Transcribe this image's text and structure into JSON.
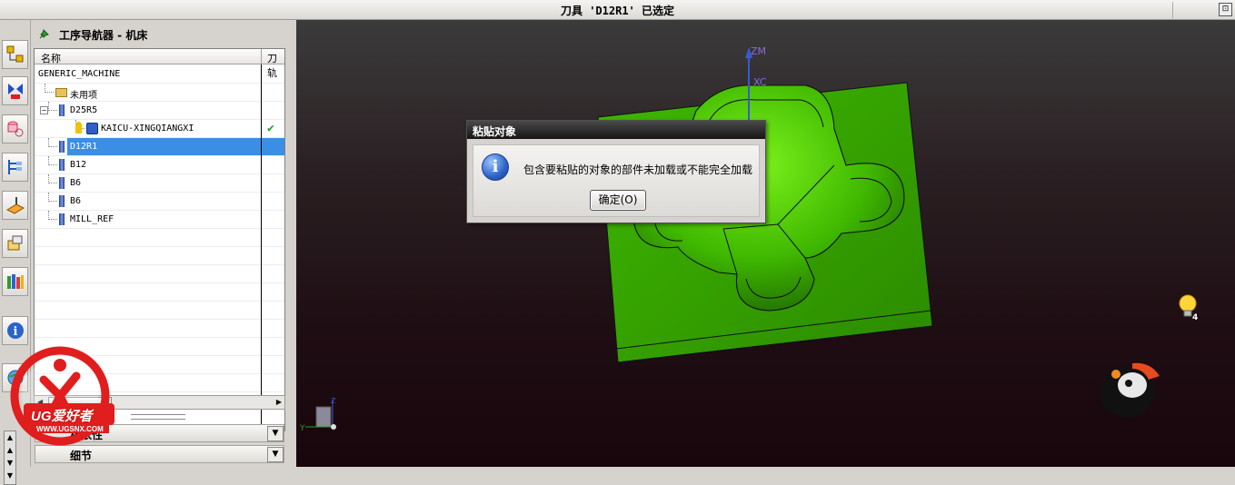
{
  "titlebar": {
    "title": "刀具 'D12R1' 已选定",
    "window_button": "⊡"
  },
  "navigator": {
    "title": "工序导航器 - 机床",
    "columns": {
      "name": "名称",
      "tool": "刀轨"
    },
    "rows": [
      {
        "label": "GENERIC_MACHINE",
        "icon": "none",
        "check": ""
      },
      {
        "label": "未用项",
        "icon": "folder-icon",
        "check": ""
      },
      {
        "label": "D25R5",
        "icon": "tool-icon",
        "check": ""
      },
      {
        "label": "KAICU-XINGQIANGXI",
        "icon": "operation-icon",
        "check": "✔"
      },
      {
        "label": "D12R1",
        "icon": "tool-icon",
        "check": "",
        "selected": true
      },
      {
        "label": "B12",
        "icon": "tool-icon",
        "check": ""
      },
      {
        "label": "B6",
        "icon": "tool-icon",
        "check": ""
      },
      {
        "label": "B6",
        "icon": "tool-icon",
        "check": ""
      },
      {
        "label": "MILL_REF",
        "icon": "tool-icon",
        "check": ""
      }
    ],
    "bottom_panels": [
      {
        "label": "相依性"
      },
      {
        "label": "细节"
      }
    ]
  },
  "viewport": {
    "axis_labels": {
      "zm": "ZM",
      "zc": "XC",
      "triad_y": "Y",
      "triad_x": "X",
      "triad_z": "Z"
    },
    "bulb_count": "4"
  },
  "dialog": {
    "title": "粘贴对象",
    "message": "包含要粘贴的对象的部件未加载或不能完全加载",
    "ok_label": "确定(O)"
  },
  "watermark": {
    "text": "UG爱好者",
    "url": "WWW.UGSNX.COM"
  },
  "colors": {
    "part_green": "#38a000",
    "selection_blue": "#3b8ee6",
    "viewport_top": "#3b3b3b",
    "viewport_bottom": "#18060c"
  }
}
